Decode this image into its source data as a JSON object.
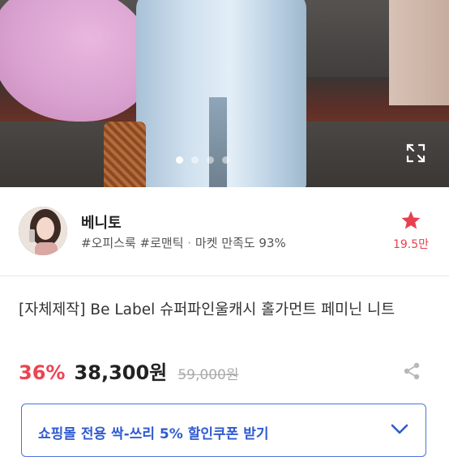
{
  "hero": {
    "image_icon": "product-photo",
    "carousel": {
      "total": 4,
      "active_index": 1
    },
    "expand_icon": "expand-icon"
  },
  "seller": {
    "name": "베니토",
    "tags": "#오피스룩 #로맨틱",
    "separator": "·",
    "satisfaction": "마켓 만족도 93%",
    "favorite_icon": "star-icon",
    "favorite_count": "19.5만"
  },
  "product": {
    "title": "[자체제작] Be Label 슈퍼파인울캐시 홀가먼트 페미닌 니트",
    "discount": "36%",
    "price": "38,300원",
    "original_price": "59,000원",
    "share_icon": "share-icon"
  },
  "coupon": {
    "label": "쇼핑몰 전용 싹-쓰리 5% 할인쿠폰 받기",
    "icon": "chevron-down-icon"
  },
  "colors": {
    "accent_red": "#ec4452",
    "accent_blue": "#2f5bd0",
    "star": "#e8404f"
  }
}
